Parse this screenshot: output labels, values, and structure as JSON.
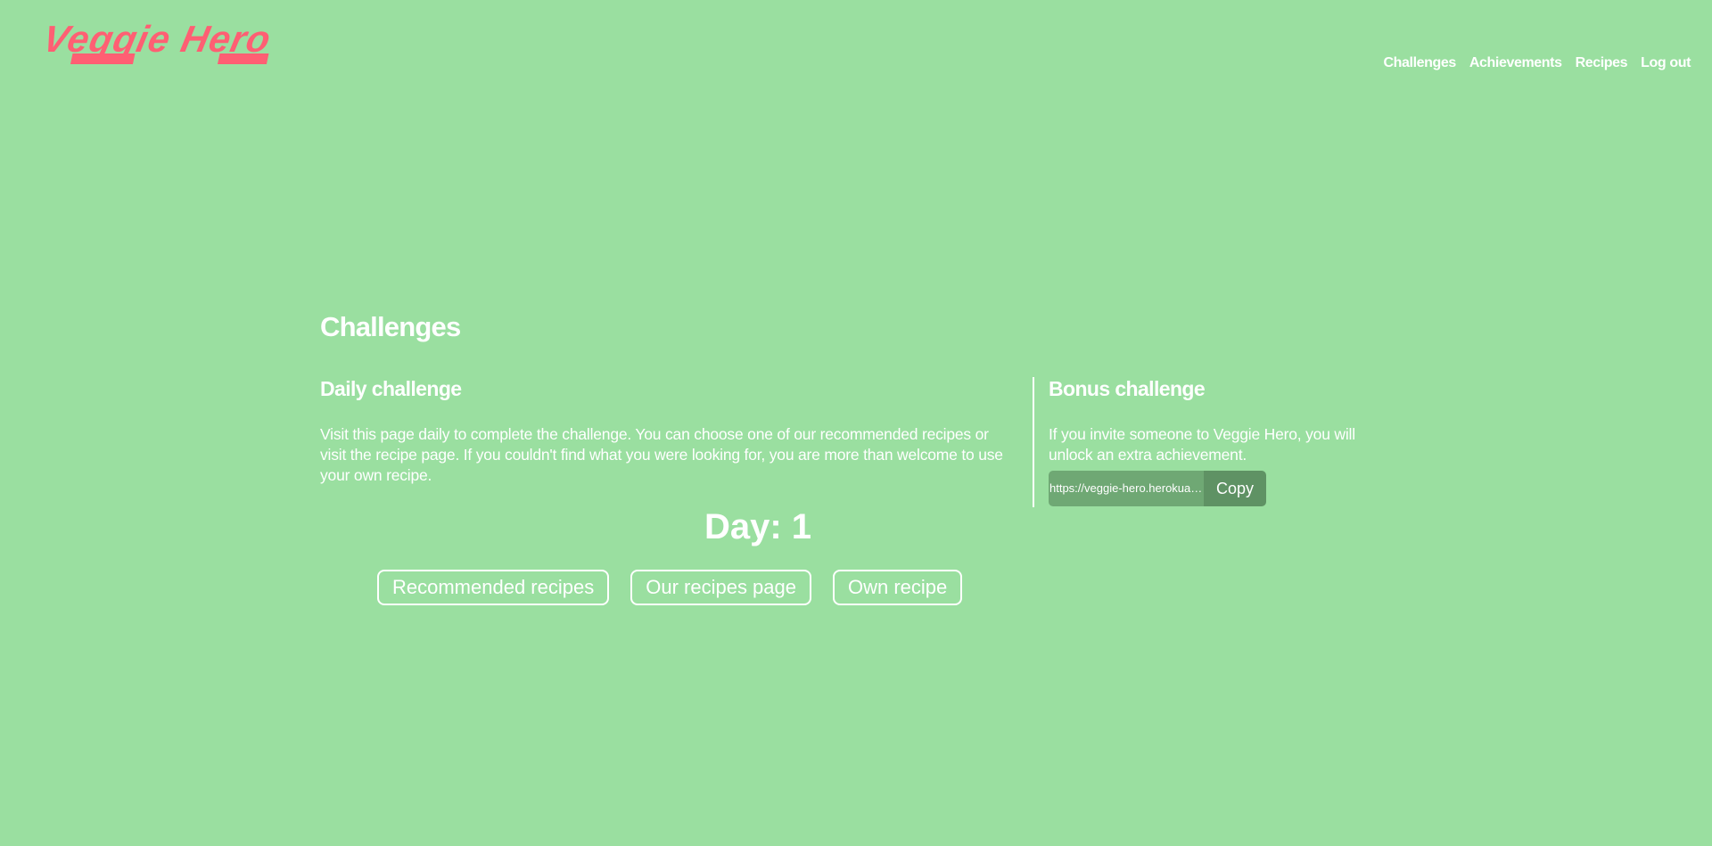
{
  "header": {
    "logo_text": "Veggie Hero",
    "nav": [
      {
        "label": "Challenges"
      },
      {
        "label": "Achievements"
      },
      {
        "label": "Recipes"
      },
      {
        "label": "Log out"
      }
    ]
  },
  "main": {
    "title": "Challenges",
    "daily": {
      "title": "Daily challenge",
      "description": "Visit this page daily to complete the challenge. You can choose one of our recommended recipes or visit the recipe page. If you couldn't find what you were looking for, you are more than welcome to use your own recipe.",
      "day_text": "Day: 1",
      "buttons": [
        {
          "label": "Recommended recipes"
        },
        {
          "label": "Our recipes page"
        },
        {
          "label": "Own recipe"
        }
      ]
    },
    "bonus": {
      "title": "Bonus challenge",
      "description": "If you invite someone to Veggie Hero, you will unlock an extra achievement.",
      "share_url": "https://veggie-hero.herokuapp.com",
      "copy_label": "Copy"
    }
  },
  "colors": {
    "background": "#9adfa0",
    "logo": "#ff5f73",
    "text": "#ffffff",
    "share_field": "#6fa874",
    "copy_button": "#5f9264"
  }
}
